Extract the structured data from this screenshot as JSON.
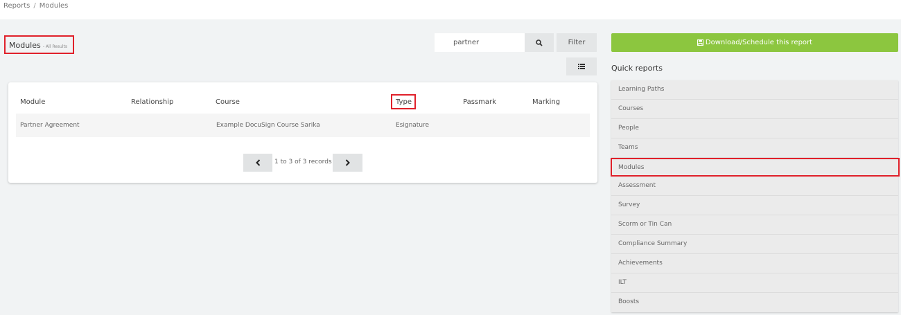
{
  "breadcrumb": {
    "items": [
      "Reports",
      "Modules"
    ],
    "separator": "/"
  },
  "page": {
    "title": "Modules",
    "subtitle": "- All Results"
  },
  "search": {
    "value": "partner"
  },
  "toolbar": {
    "filter_label": "Filter"
  },
  "table": {
    "columns": [
      "Module",
      "Relationship",
      "Course",
      "Type",
      "Passmark",
      "Marking"
    ],
    "rows": [
      [
        "Partner Agreement",
        "",
        "Example DocuSign Course Sarika",
        "Esignature",
        "",
        ""
      ]
    ]
  },
  "pagination": {
    "text": "1 to 3 of 3 records"
  },
  "download": {
    "label": "Download/Schedule this report"
  },
  "quick_reports": {
    "heading": "Quick reports",
    "items": [
      "Learning Paths",
      "Courses",
      "People",
      "Teams",
      "Modules",
      "Assessment",
      "Survey",
      "Scorm or Tin Can",
      "Compliance Summary",
      "Achievements",
      "ILT",
      "Boosts"
    ],
    "selected": "Modules"
  },
  "colors": {
    "accent_green": "#8cc63f",
    "highlight_red": "#e0202a"
  },
  "icons": {
    "search": "search-icon",
    "list": "list-icon",
    "prev": "chevron-left-icon",
    "next": "chevron-right-icon",
    "download": "save-icon"
  }
}
